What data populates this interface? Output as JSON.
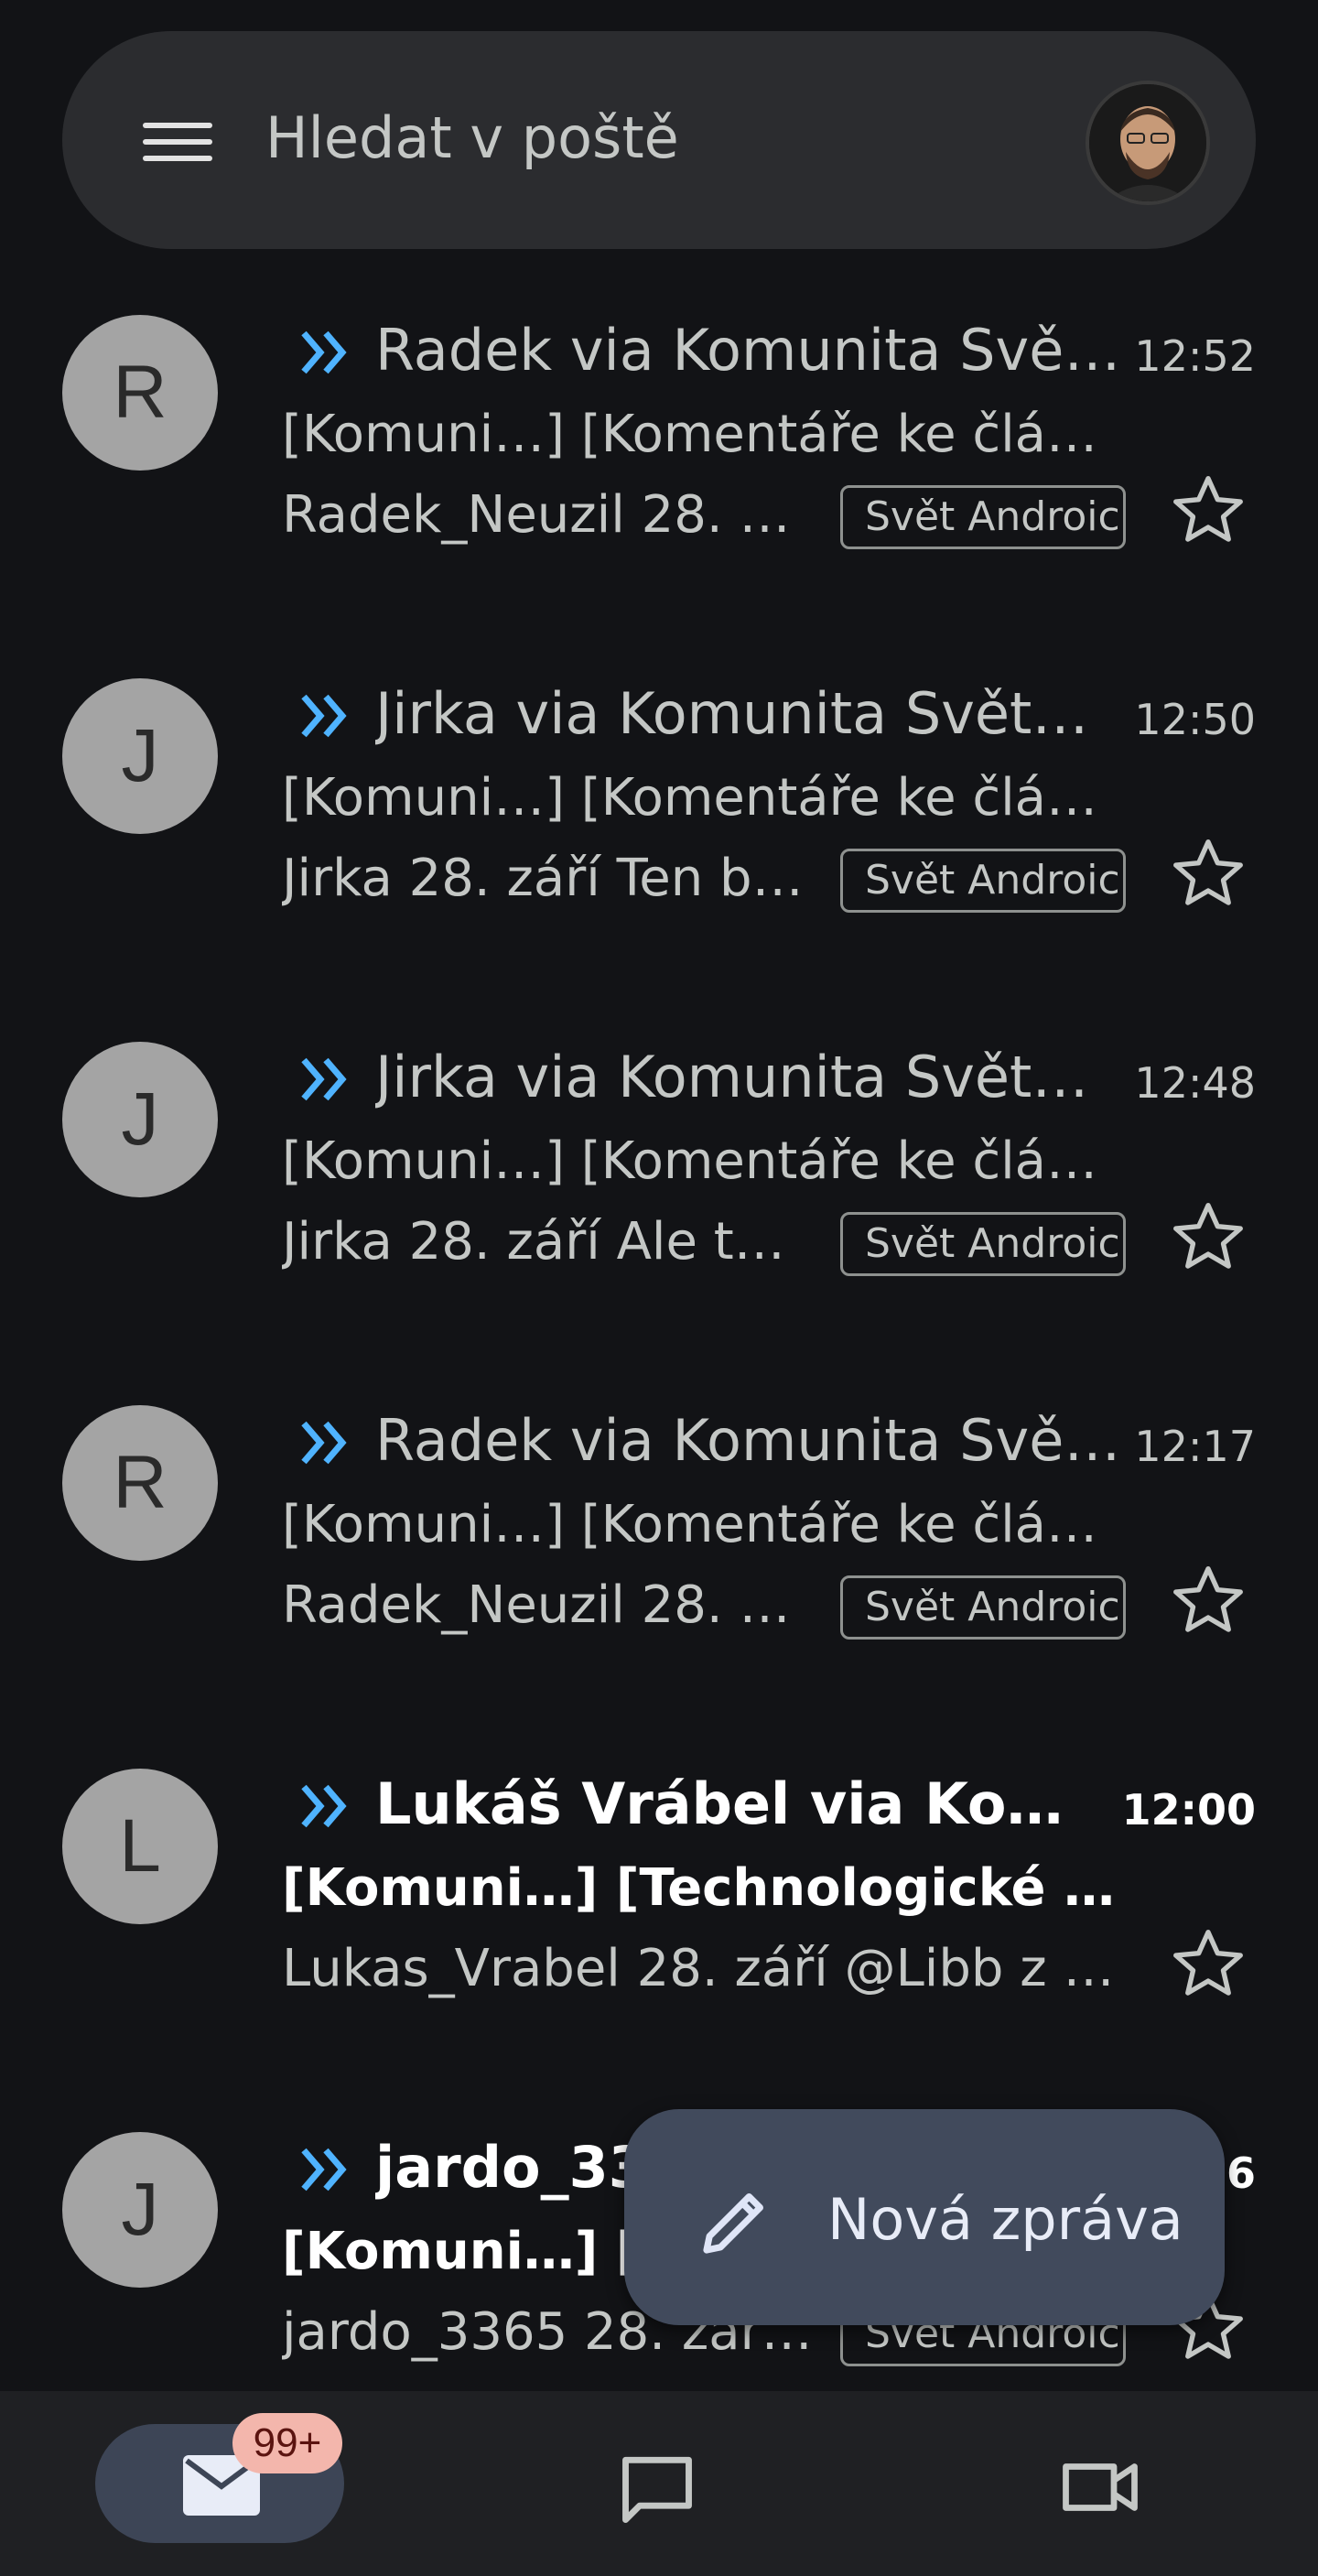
{
  "search": {
    "placeholder_text": "Hledat v poště",
    "menu_icon": "hamburger-menu-icon",
    "account_icon": "account-avatar"
  },
  "emails": [
    {
      "avatar_letter": "R",
      "sender": "Radek via Komunita Svět…",
      "time": "12:52",
      "subject": "[Komuni…] [Komentáře ke článk…",
      "snippet": "Radek_Neuzil 28. zá…",
      "label": "Svět Androic",
      "unread": false
    },
    {
      "avatar_letter": "J",
      "sender": "Jirka via Komunita Svět…",
      "time": "12:50",
      "subject": "[Komuni…] [Komentáře ke článk…",
      "snippet": "Jirka 28. září Ten by…",
      "label": "Svět Androic",
      "unread": false
    },
    {
      "avatar_letter": "J",
      "sender": "Jirka via Komunita Svět…",
      "time": "12:48",
      "subject": "[Komuni…] [Komentáře ke článk…",
      "snippet": "Jirka 28. září Ale ty…",
      "label": "Svět Androic",
      "unread": false
    },
    {
      "avatar_letter": "R",
      "sender": "Radek via Komunita Svět…",
      "time": "12:17",
      "subject": "[Komuni…] [Komentáře ke článk…",
      "snippet": "Radek_Neuzil 28. zá…",
      "label": "Svět Androic",
      "unread": false
    },
    {
      "avatar_letter": "L",
      "sender": "Lukáš Vrábel via Kom…",
      "time": "12:00",
      "subject": "[Komuni…] [Technologické no…",
      "snippet": "Lukas_Vrabel 28. září @Libb z cl…",
      "label": "",
      "unread": true
    },
    {
      "avatar_letter": "J",
      "sender": "jardo_33",
      "time": "6",
      "subject": "[Komuni…] [K",
      "snippet": "jardo_3365 28. září…",
      "label": "Svět Androic",
      "unread": true
    }
  ],
  "compose": {
    "label": "Nová zpráva",
    "icon": "pencil-icon"
  },
  "bottom_nav": {
    "mail_badge": "99+",
    "mail_icon": "mail-icon",
    "chat_icon": "chat-icon",
    "meet_icon": "video-icon"
  },
  "colors": {
    "background": "#121316",
    "accent_importance": "#4fb3ff",
    "fab": "#414a5c",
    "badge": "#f3b6ac"
  }
}
